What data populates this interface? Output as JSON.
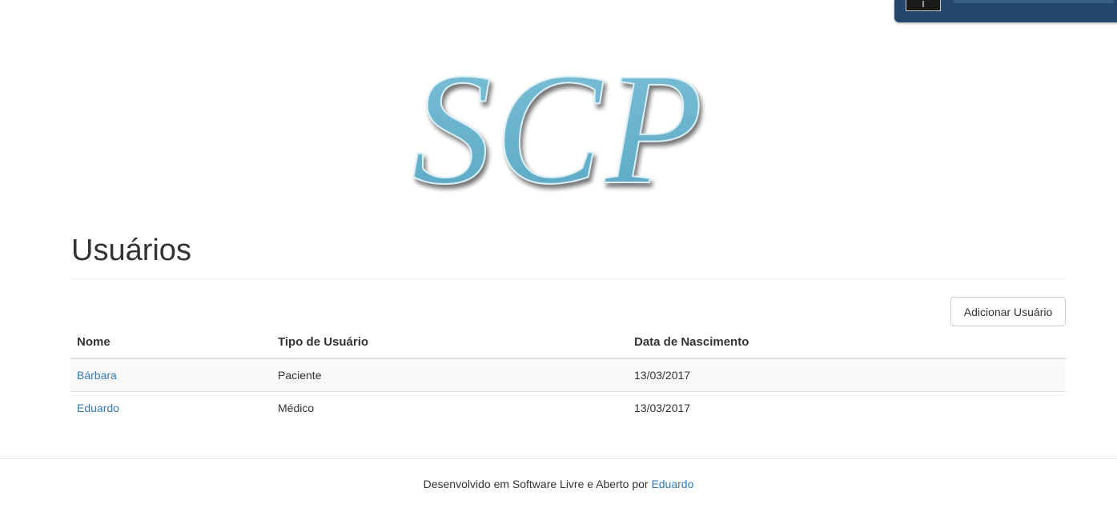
{
  "logo": {
    "text": "SCP",
    "color": "#6cb3cd"
  },
  "page": {
    "title": "Usuários"
  },
  "actions": {
    "add_user_label": "Adicionar Usuário"
  },
  "table": {
    "headers": {
      "nome": "Nome",
      "tipo": "Tipo de Usuário",
      "data": "Data de Nascimento"
    },
    "rows": [
      {
        "nome": "Bárbara",
        "tipo": "Paciente",
        "data": "13/03/2017"
      },
      {
        "nome": "Eduardo",
        "tipo": "Médico",
        "data": "13/03/2017"
      }
    ]
  },
  "footer": {
    "text": "Desenvolvido em Software Livre e Aberto por",
    "link_label": "Eduardo"
  },
  "colors": {
    "link": "#337ab7",
    "text": "#333333",
    "widget_bg": "#23486b"
  }
}
